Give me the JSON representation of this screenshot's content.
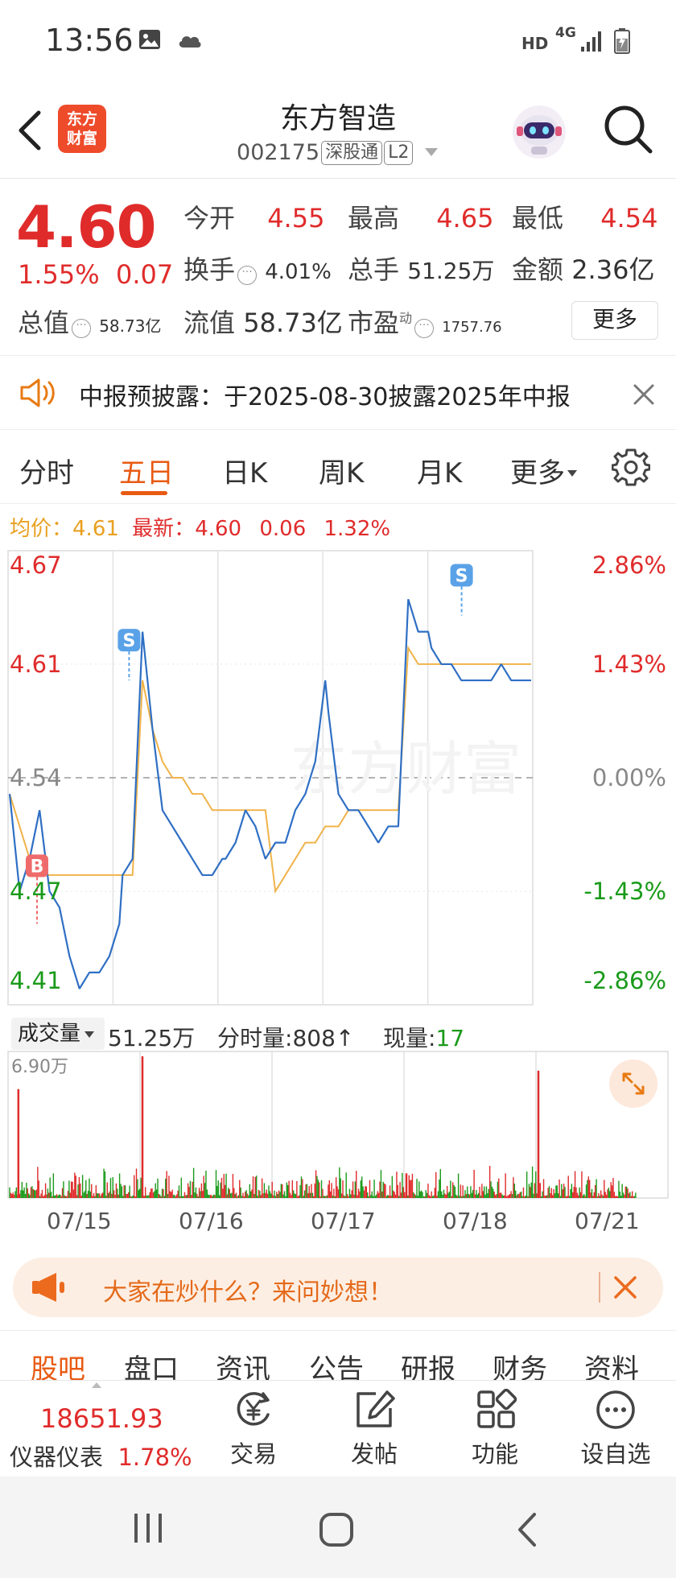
{
  "status_bar": {
    "time": "13:56",
    "indicators": [
      "image-icon",
      "cloud-icon",
      "HD",
      "4G",
      "signal-icon",
      "battery-icon"
    ]
  },
  "header": {
    "app_logo_text": [
      "东方",
      "财富"
    ],
    "stock_name": "东方智造",
    "stock_code": "002175",
    "tags": [
      "深股通",
      "L2"
    ]
  },
  "quote": {
    "price": "4.60",
    "change_pct": "1.55%",
    "change_amt": "0.07",
    "rows": [
      [
        {
          "label": "今开",
          "value": "4.55"
        },
        {
          "label": "最高",
          "value": "4.65"
        },
        {
          "label": "最低",
          "value": "4.54"
        }
      ],
      [
        {
          "label": "换手",
          "value": "4.01%"
        },
        {
          "label": "总手",
          "value": "51.25万"
        },
        {
          "label": "金额",
          "value": "2.36亿"
        }
      ],
      [
        {
          "label": "总值",
          "value": "58.73亿"
        },
        {
          "label": "流值",
          "value": "58.73亿"
        },
        {
          "label": "市盈",
          "sup": "动",
          "value": "1757.76"
        }
      ]
    ],
    "more_label": "更多"
  },
  "notice": {
    "text": "中报预披露：于2025-08-30披露2025年中报"
  },
  "chart_tabs": {
    "items": [
      "分时",
      "五日",
      "日K",
      "周K",
      "月K",
      "更多"
    ],
    "active": "五日"
  },
  "avg_line": {
    "avg_label": "均价：",
    "avg_value": "4.61",
    "latest_label": "最新：",
    "latest_value": "4.60",
    "chg": "0.06",
    "chg_pct": "1.32%"
  },
  "chart_data": [
    {
      "type": "line",
      "title": "",
      "series": [
        {
          "name": "",
          "values": [
            4.53,
            4.47,
            4.49,
            4.52,
            4.47,
            4.46,
            4.43,
            4.41,
            4.42,
            4.42,
            4.43,
            4.45,
            4.48,
            4.49,
            4.63,
            4.57,
            4.52,
            4.51,
            4.5,
            4.49,
            4.48,
            4.48,
            4.49,
            4.49,
            4.5,
            4.52,
            4.51,
            4.49,
            4.5,
            4.5,
            4.52,
            4.53,
            4.55,
            4.6,
            4.58,
            4.53,
            4.52,
            4.52,
            4.51,
            4.5,
            4.51,
            4.51,
            4.65,
            4.63,
            4.63,
            4.62,
            4.61,
            4.61,
            4.6,
            4.6,
            4.6,
            4.6,
            4.61,
            4.6,
            4.6,
            4.6
          ],
          "x_labels": [
            "07/15",
            "07/16",
            "07/17",
            "07/18",
            "07/21"
          ]
        }
      ],
      "avg_series": [
        4.53,
        4.51,
        4.49,
        4.48,
        4.48,
        4.48,
        4.48,
        4.48,
        4.48,
        4.48,
        4.48,
        4.48,
        4.48,
        4.48,
        4.6,
        4.57,
        4.55,
        4.54,
        4.54,
        4.53,
        4.53,
        4.52,
        4.52,
        4.52,
        4.52,
        4.52,
        4.52,
        4.52,
        4.47,
        4.48,
        4.49,
        4.5,
        4.5,
        4.51,
        4.51,
        4.51,
        4.52,
        4.52,
        4.52,
        4.52,
        4.52,
        4.52,
        4.62,
        4.61,
        4.61,
        4.61,
        4.61,
        4.61,
        4.61,
        4.61,
        4.61,
        4.61,
        4.61,
        4.61,
        4.61,
        4.61
      ],
      "y_labels_left": [
        "4.67",
        "4.61",
        "4.54",
        "4.47",
        "4.41"
      ],
      "y_labels_right": [
        "2.86%",
        "1.43%",
        "0.00%",
        "-1.43%",
        "-2.86%"
      ],
      "ylim": [
        4.41,
        4.67
      ],
      "grid": true,
      "markers": [
        {
          "label": "B",
          "day": 0,
          "value": 4.45
        },
        {
          "label": "S",
          "day": 1,
          "value": 4.6
        },
        {
          "label": "S",
          "day": 4,
          "value": 4.64
        }
      ]
    },
    {
      "type": "bar",
      "title": "",
      "ymax_label": "6.90万",
      "ylim": [
        0,
        6.9
      ],
      "spikes": [
        {
          "day": 0,
          "pos": 0.06,
          "value": 5.3,
          "color": "red"
        },
        {
          "day": 1,
          "pos": 0.0,
          "value": 6.9,
          "color": "red"
        },
        {
          "day": 3,
          "pos": 0.0,
          "value": 1.2,
          "color": "red"
        },
        {
          "day": 4,
          "pos": 0.0,
          "value": 6.2,
          "color": "red"
        }
      ]
    }
  ],
  "volume_header": {
    "label": "成交量",
    "total": "51.25万",
    "fs_label": "分时量:",
    "fs_value": "808",
    "arrow": "↑",
    "now_label": "现量:",
    "now_value": "17"
  },
  "date_axis": [
    "07/15",
    "07/16",
    "07/17",
    "07/18",
    "07/21"
  ],
  "banner": {
    "text": "大家在炒什么？来问妙想！"
  },
  "bottom_tabs": {
    "items": [
      "股吧",
      "盘口",
      "资讯",
      "公告",
      "研报",
      "财务",
      "资料"
    ],
    "active": "股吧"
  },
  "toolbar": {
    "index_value": "18651.93",
    "index_name": "仪器仪表",
    "index_pct": "1.78%",
    "tools": [
      {
        "label": "交易",
        "icon": "yen-cycle-icon"
      },
      {
        "label": "发帖",
        "icon": "edit-icon"
      },
      {
        "label": "功能",
        "icon": "grid-icon"
      },
      {
        "label": "设自选",
        "icon": "more-circle-icon"
      }
    ]
  },
  "colors": {
    "red": "#e02b2b",
    "green": "#1a9a1a",
    "accent": "#e85a12",
    "price_line": "#2f6fc4",
    "avg_line": "#f0b34a"
  }
}
